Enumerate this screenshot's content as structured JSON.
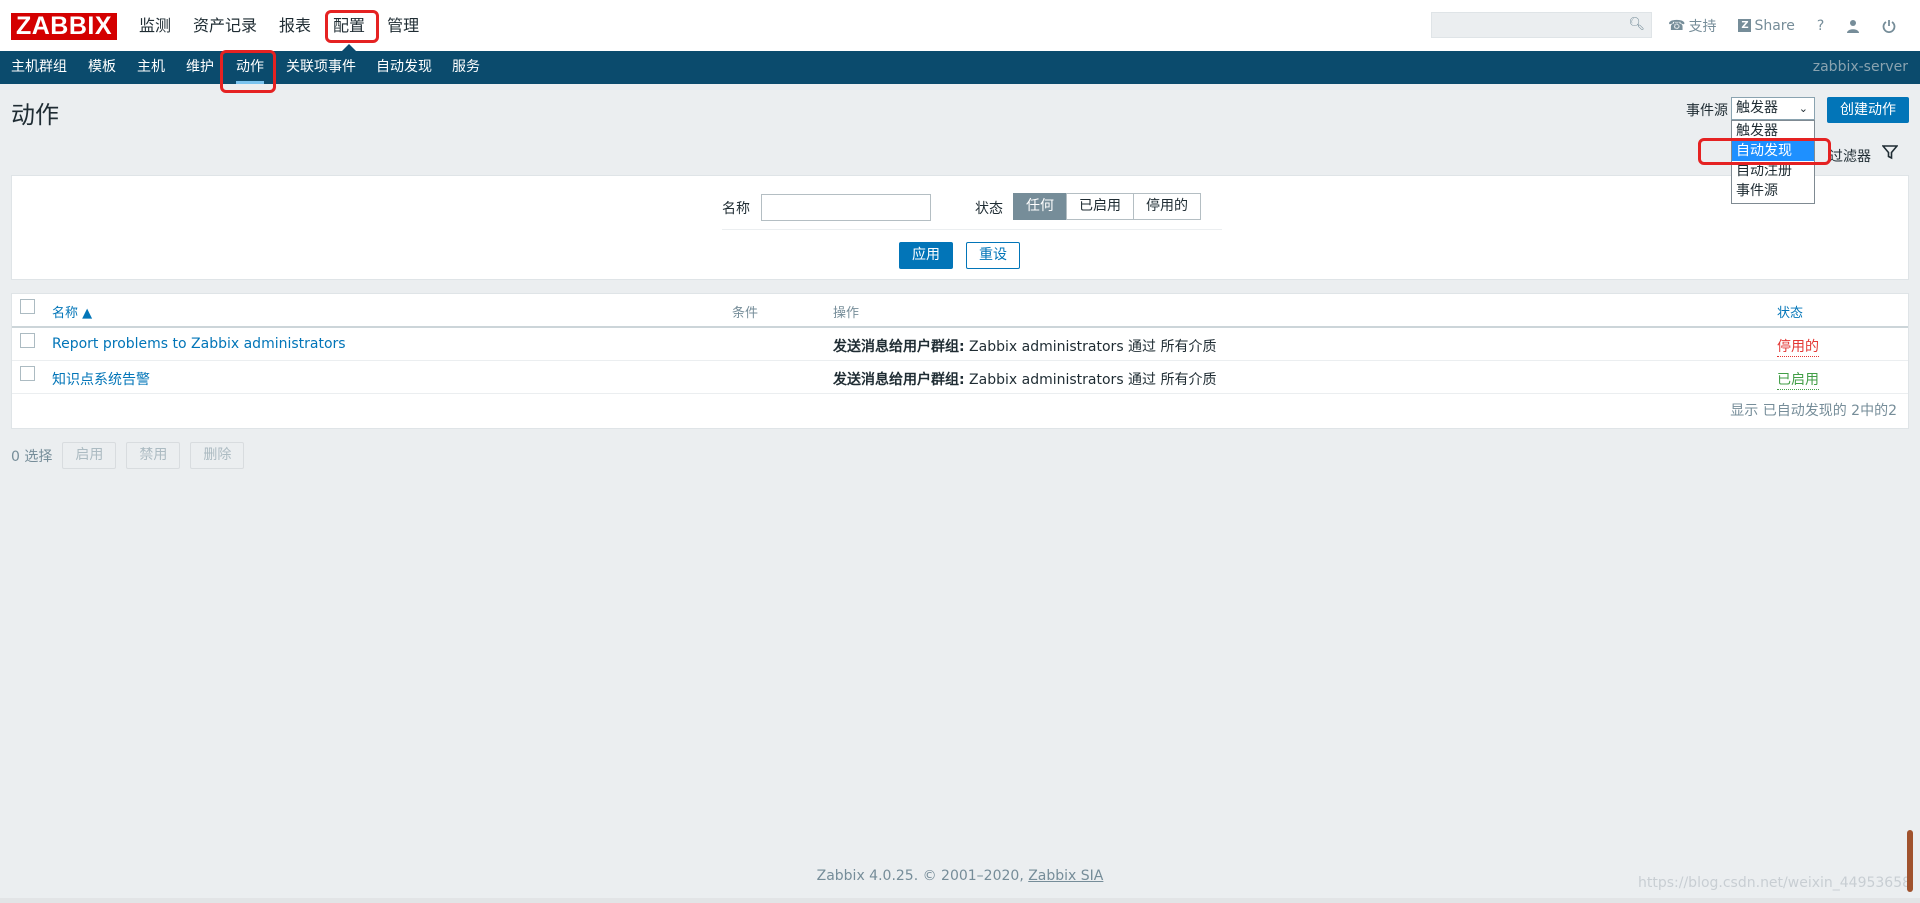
{
  "logo": "ZABBIX",
  "top_menu": [
    {
      "label": "监测"
    },
    {
      "label": "资产记录"
    },
    {
      "label": "报表"
    },
    {
      "label": "配置",
      "selected": true
    },
    {
      "label": "管理"
    }
  ],
  "search": {
    "placeholder": "",
    "icon": "search-icon"
  },
  "top_icons": {
    "support": "支持",
    "share": "Share",
    "help": "?",
    "profile_icon": "user-icon",
    "logout_icon": "power-icon"
  },
  "sub_menu": [
    {
      "label": "主机群组"
    },
    {
      "label": "模板"
    },
    {
      "label": "主机"
    },
    {
      "label": "维护"
    },
    {
      "label": "动作",
      "selected": true
    },
    {
      "label": "关联项事件"
    },
    {
      "label": "自动发现"
    },
    {
      "label": "服务"
    }
  ],
  "server_name": "zabbix-server",
  "page_title": "动作",
  "event_source": {
    "label": "事件源",
    "selected": "触发器",
    "options": [
      "触发器",
      "自动发现",
      "自动注册",
      "事件源"
    ],
    "highlighted": "自动发现"
  },
  "create_button": "创建动作",
  "filter": {
    "tab_label": "过滤器",
    "name_label": "名称",
    "name_value": "",
    "status_label": "状态",
    "status_options": [
      "任何",
      "已启用",
      "停用的"
    ],
    "status_selected": "任何",
    "apply": "应用",
    "reset": "重设"
  },
  "table": {
    "headers": {
      "name": "名称 ▲",
      "conditions": "条件",
      "operations": "操作",
      "status": "状态"
    },
    "rows": [
      {
        "name": "Report problems to Zabbix administrators",
        "op_bold": "发送消息给用户群组:",
        "op_rest": " Zabbix administrators 通过 所有介质",
        "status": "停用的"
      },
      {
        "name": "知识点系统告警",
        "op_bold": "发送消息给用户群组:",
        "op_rest": " Zabbix administrators 通过 所有介质",
        "status": "已启用"
      }
    ],
    "footer": "显示 已自动发现的 2中的2"
  },
  "bottom_actions": {
    "selected_count": "0 选择",
    "enable": "启用",
    "disable": "禁用",
    "delete": "删除"
  },
  "footer": {
    "text": "Zabbix 4.0.25. © 2001–2020, ",
    "link": "Zabbix SIA"
  },
  "watermark": "https://blog.csdn.net/weixin_44953658",
  "colors": {
    "brand_red": "#d40000",
    "nav_blue": "#0b4b6d",
    "accent_blue": "#0275b8",
    "annotation_red": "#e52222"
  }
}
